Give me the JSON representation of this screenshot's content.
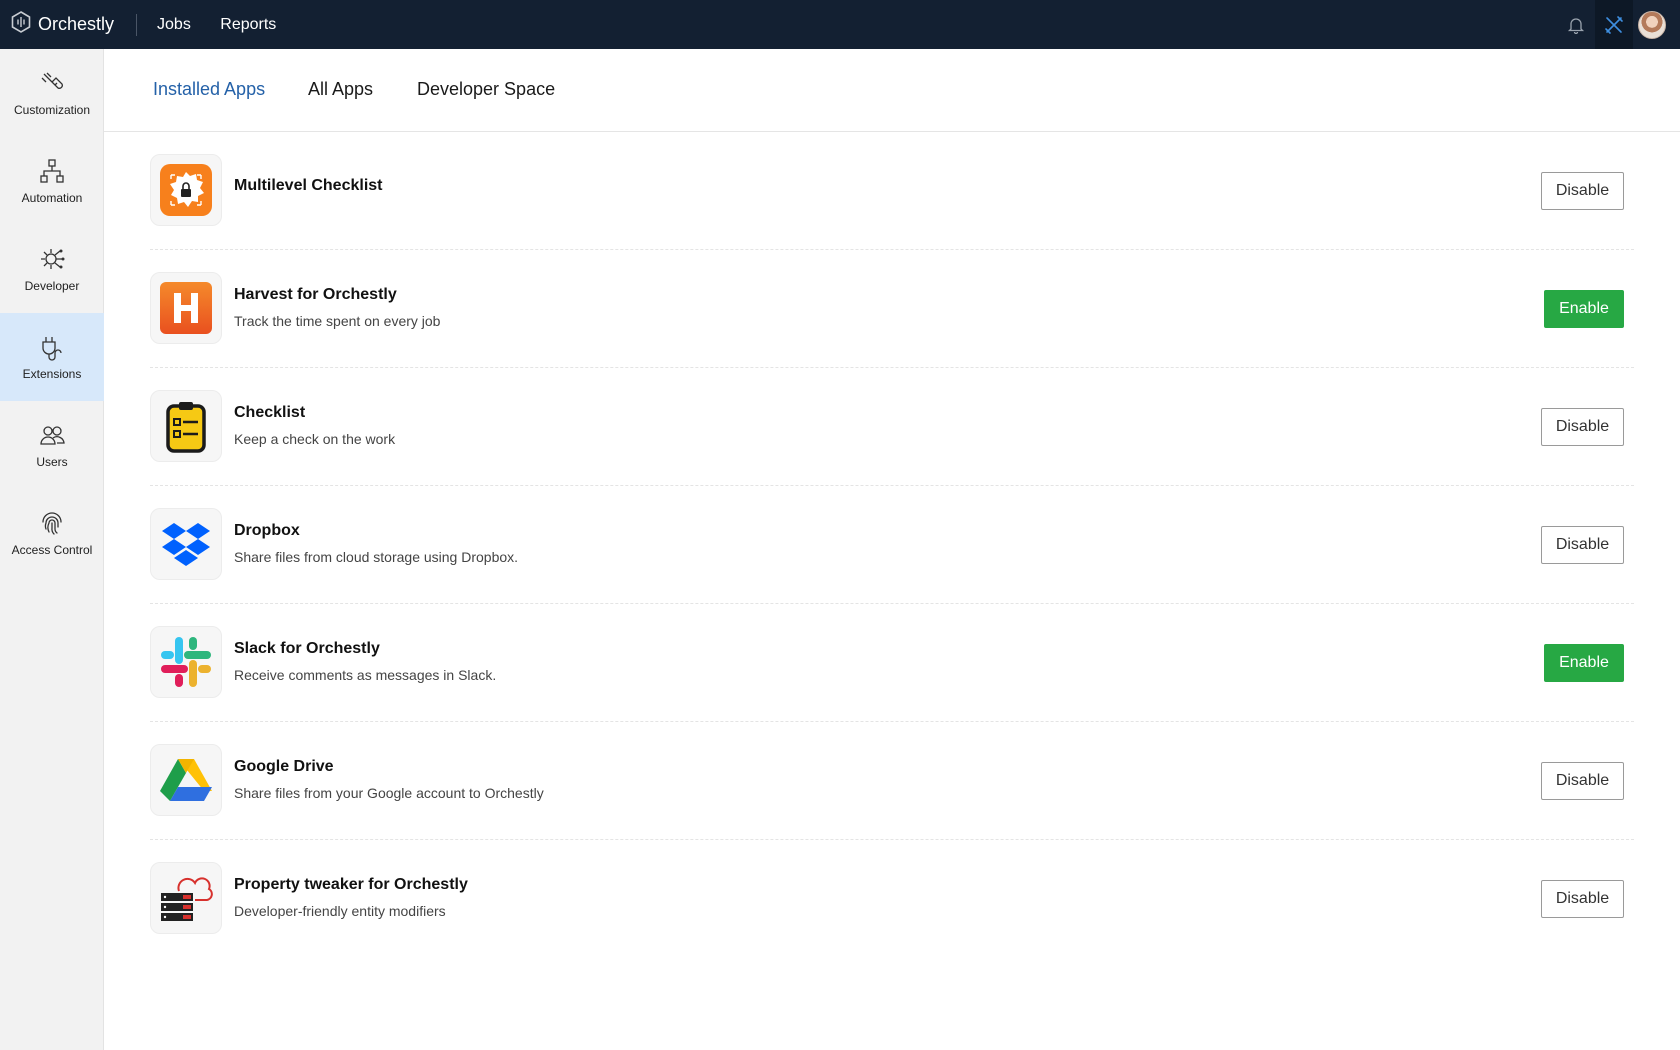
{
  "topbar": {
    "brand": "Orchestly",
    "nav": [
      "Jobs",
      "Reports"
    ],
    "icons": [
      "bell-icon",
      "tools-icon",
      "avatar"
    ]
  },
  "sidebar": {
    "items": [
      {
        "label": "Customization",
        "icon": "brush-icon"
      },
      {
        "label": "Automation",
        "icon": "hierarchy-icon"
      },
      {
        "label": "Developer",
        "icon": "gear-circuit-icon"
      },
      {
        "label": "Extensions",
        "icon": "plug-icon",
        "active": true
      },
      {
        "label": "Users",
        "icon": "users-icon"
      },
      {
        "label": "Access Control",
        "icon": "fingerprint-icon"
      }
    ]
  },
  "tabs": [
    {
      "label": "Installed Apps",
      "active": true
    },
    {
      "label": "All Apps"
    },
    {
      "label": "Developer Space"
    }
  ],
  "apps": [
    {
      "name": "Multilevel Checklist",
      "desc": "",
      "action": "Disable",
      "icon": "multilevel-checklist-icon"
    },
    {
      "name": "Harvest for Orchestly",
      "desc": "Track the time spent on every job",
      "action": "Enable",
      "icon": "harvest-icon"
    },
    {
      "name": "Checklist",
      "desc": "Keep a check on the work",
      "action": "Disable",
      "icon": "checklist-icon"
    },
    {
      "name": "Dropbox",
      "desc": "Share files from cloud storage using Dropbox.",
      "action": "Disable",
      "icon": "dropbox-icon"
    },
    {
      "name": "Slack for Orchestly",
      "desc": "Receive comments as messages in Slack.",
      "action": "Enable",
      "icon": "slack-icon"
    },
    {
      "name": "Google Drive",
      "desc": "Share files from your Google account to Orchestly",
      "action": "Disable",
      "icon": "google-drive-icon"
    },
    {
      "name": "Property tweaker for Orchestly",
      "desc": "Developer-friendly entity modifiers",
      "action": "Disable",
      "icon": "property-tweaker-icon"
    }
  ],
  "colors": {
    "topbar": "#132032",
    "active_tab": "#2461a8",
    "enable_button": "#27a844",
    "sidebar_active": "#d7e8fa"
  }
}
